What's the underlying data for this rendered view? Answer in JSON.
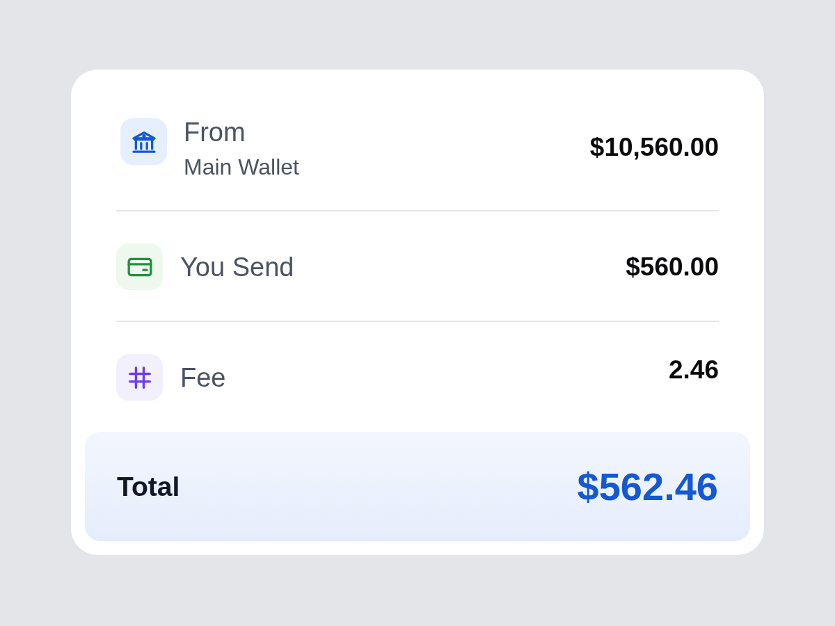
{
  "rows": [
    {
      "kind": "bank",
      "label": "From",
      "sublabel": "Main Wallet",
      "amount": "$10,560.00"
    },
    {
      "kind": "card",
      "label": "You Send",
      "amount": "$560.00"
    },
    {
      "kind": "hash",
      "label": "Fee",
      "amount": "2.46"
    }
  ],
  "total": {
    "label": "Total",
    "amount": "$562.46"
  }
}
